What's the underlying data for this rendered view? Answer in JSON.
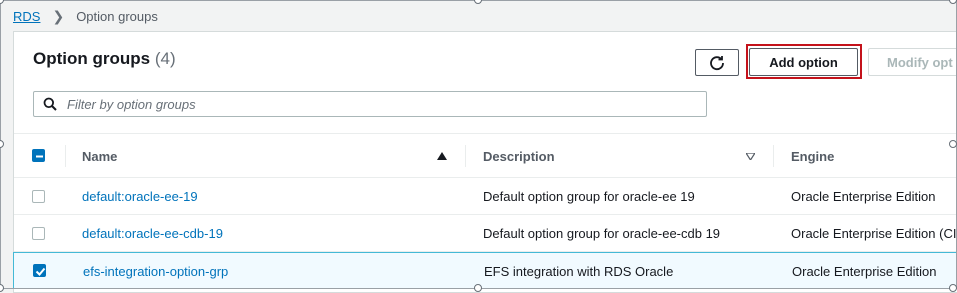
{
  "breadcrumb": {
    "root": "RDS",
    "current": "Option groups"
  },
  "header": {
    "title": "Option groups",
    "count": "(4)"
  },
  "toolbar": {
    "refresh_icon": "refresh-icon",
    "add_label": "Add option",
    "modify_label": "Modify opt"
  },
  "search": {
    "placeholder": "Filter by option groups",
    "value": "",
    "icon": "search-icon"
  },
  "table": {
    "columns": {
      "name": "Name",
      "description": "Description",
      "engine": "Engine"
    },
    "sort": {
      "name": "ascending-triangle-icon",
      "description": "descending-triangle-icon"
    },
    "header_checkbox": "indeterminate",
    "rows": [
      {
        "name": "default:oracle-ee-19",
        "description": "Default option group for oracle-ee 19",
        "engine": "Oracle Enterprise Edition",
        "selected": false
      },
      {
        "name": "default:oracle-ee-cdb-19",
        "description": "Default option group for oracle-ee-cdb 19",
        "engine": "Oracle Enterprise Edition (CI",
        "selected": false
      },
      {
        "name": "efs-integration-option-grp",
        "description": "EFS integration with RDS Oracle",
        "engine": "Oracle Enterprise Edition",
        "selected": true
      }
    ]
  },
  "colors": {
    "link": "#0073bb",
    "highlight": "#c4121b",
    "selected_row": "#f1faff",
    "selected_border": "#44b9d6"
  }
}
